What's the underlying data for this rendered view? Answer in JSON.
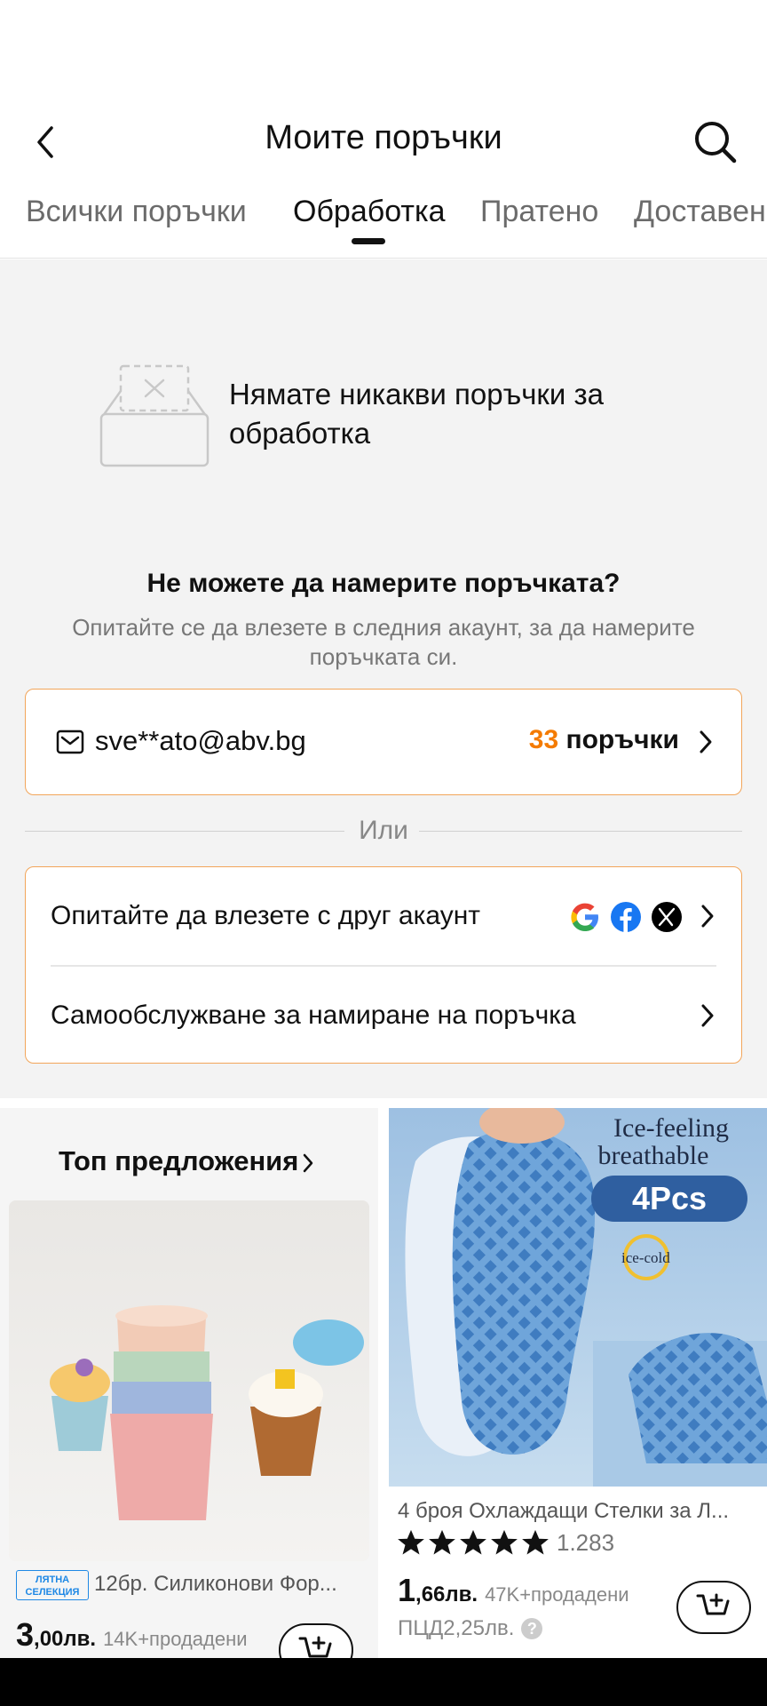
{
  "header": {
    "title": "Моите поръчки"
  },
  "tabs": [
    {
      "label": "Всички поръчки",
      "active": false
    },
    {
      "label": "Обработка",
      "active": true
    },
    {
      "label": "Пратено",
      "active": false
    },
    {
      "label": "Доставено",
      "active": false
    }
  ],
  "empty_state": {
    "message": "Нямате никакви поръчки за обработка"
  },
  "cant_find": {
    "title": "Не можете да намерите поръчката?",
    "subtitle": "Опитайте се да влезете в следния акаунт, за да намерите поръчката си."
  },
  "account": {
    "email": "sve**ato@abv.bg",
    "orders_number": "33",
    "orders_label": " поръчки"
  },
  "divider": {
    "or_label": "Или"
  },
  "options": {
    "other_account": "Опитайте да влезете с друг акаунт",
    "self_service": "Самообслужване за намиране на поръчка",
    "social_icons": [
      "google-icon",
      "facebook-icon",
      "x-icon"
    ]
  },
  "products": {
    "top_offers_label": "Топ предложения",
    "left": {
      "badge_line1": "ЛЯТНА",
      "badge_line2": "СЕЛЕКЦИЯ",
      "title": "12бр. Силиконови Фор...",
      "price_main": "3",
      "price_fraction": ",00лв.",
      "sold": "14K+продадени"
    },
    "right": {
      "image_text_1": "Ice-feeling",
      "image_text_2": "breathable",
      "image_text_3": "4Pcs",
      "image_text_4": "ice-cold",
      "title": "4 броя Охлаждащи Стелки за Л...",
      "rating": "1.283",
      "stars": 5,
      "price_main": "1",
      "price_fraction": ",66лв.",
      "sold": "47K+продадени",
      "ref_price": "ПЦД2,25лв."
    }
  },
  "colors": {
    "accent": "#f47b00",
    "card_border": "#f2a55a",
    "badge": "#1e88e5"
  }
}
